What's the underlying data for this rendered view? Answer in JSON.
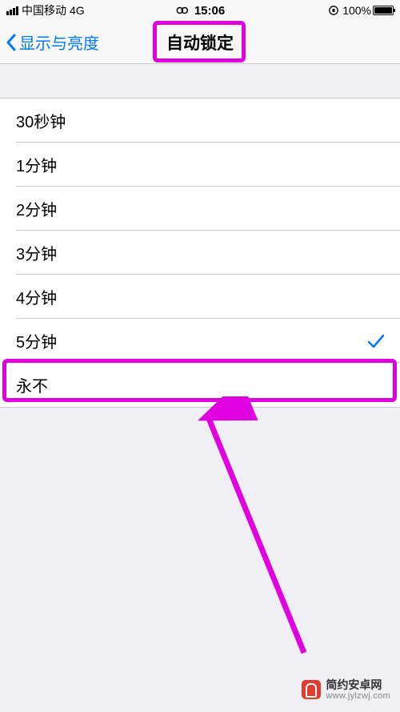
{
  "status_bar": {
    "carrier": "中国移动",
    "network_type": "4G",
    "time": "15:06",
    "battery_percent_label": "100%"
  },
  "nav": {
    "back_label": "显示与亮度",
    "title": "自动锁定"
  },
  "options": [
    {
      "label": "30秒钟",
      "selected": false
    },
    {
      "label": "1分钟",
      "selected": false
    },
    {
      "label": "2分钟",
      "selected": false
    },
    {
      "label": "3分钟",
      "selected": false
    },
    {
      "label": "4分钟",
      "selected": false
    },
    {
      "label": "5分钟",
      "selected": true
    },
    {
      "label": "永不",
      "selected": false
    }
  ],
  "annotations": {
    "highlight_color": "#e000e0",
    "highlighted_title": true,
    "highlighted_option_label": "永不",
    "arrow": true
  },
  "watermark": {
    "line1": "简约安卓网",
    "line2": "www.jylzwj.com"
  }
}
